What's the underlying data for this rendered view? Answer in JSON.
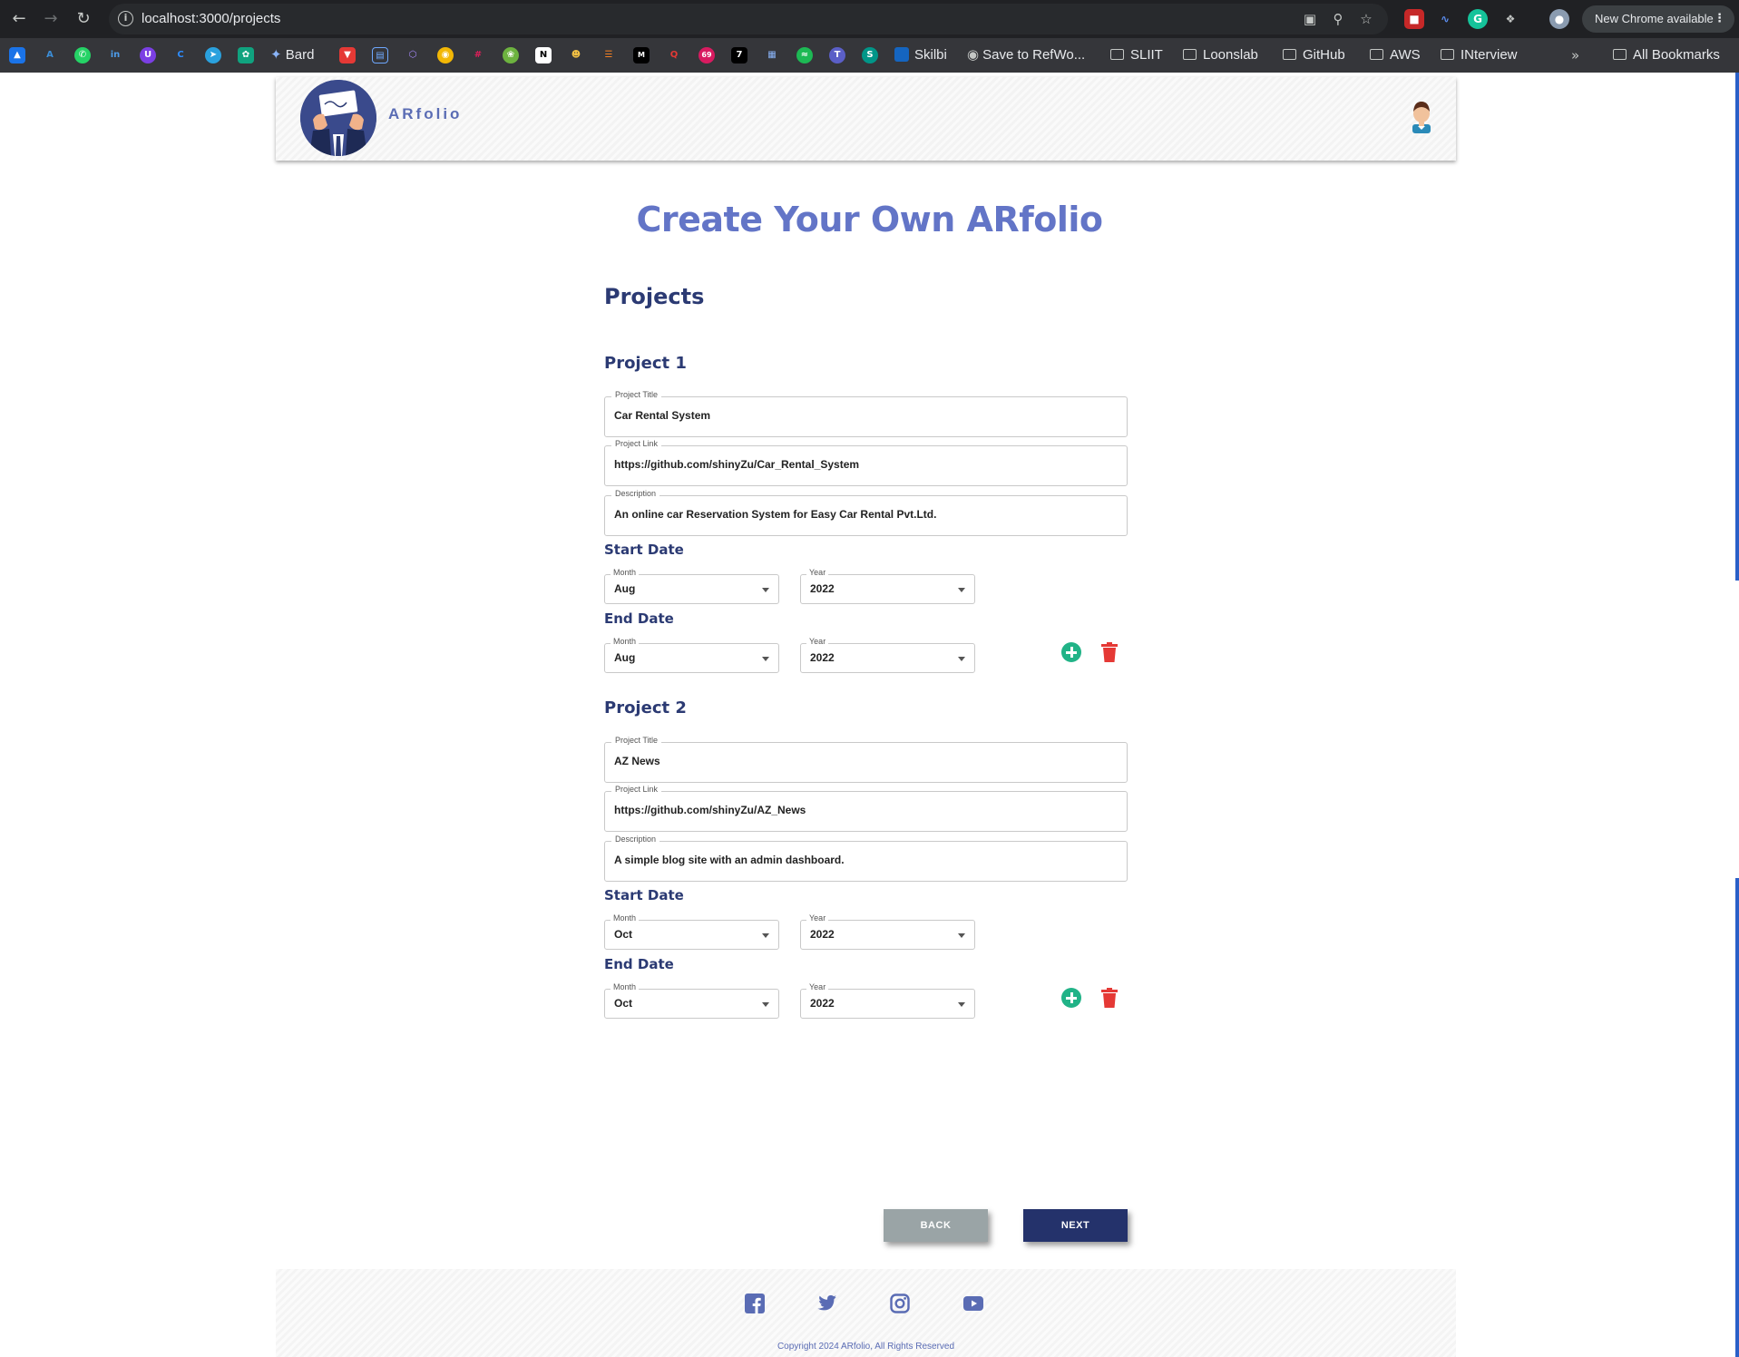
{
  "browser": {
    "url": "localhost:3000/projects",
    "update_label": "New Chrome available",
    "bookmarks": {
      "bard": "Bard",
      "skilbi": "Skilbi",
      "refworks": "Save to RefWo...",
      "sliit": "SLIIT",
      "loonslab": "Loonslab",
      "github": "GitHub",
      "aws": "AWS",
      "interview": "INterview",
      "all": "All Bookmarks"
    }
  },
  "header": {
    "brand": "ARfolio"
  },
  "page": {
    "title": "Create Your Own ARfolio",
    "section": "Projects"
  },
  "labels": {
    "project_title": "Project Title",
    "project_link": "Project Link",
    "description": "Description",
    "start_date": "Start Date",
    "end_date": "End Date",
    "month": "Month",
    "year": "Year"
  },
  "projects": [
    {
      "heading": "Project 1",
      "title": "Car Rental System",
      "link": "https://github.com/shinyZu/Car_Rental_System",
      "description": "An online car Reservation System for Easy Car Rental Pvt.Ltd.",
      "start_month": "Aug",
      "start_year": "2022",
      "end_month": "Aug",
      "end_year": "2022"
    },
    {
      "heading": "Project 2",
      "title": "AZ News",
      "link": "https://github.com/shinyZu/AZ_News",
      "description": "A simple blog site with an admin dashboard.",
      "start_month": "Oct",
      "start_year": "2022",
      "end_month": "Oct",
      "end_year": "2022"
    }
  ],
  "buttons": {
    "back": "BACK",
    "next": "NEXT"
  },
  "footer": {
    "copyright": "Copyright 2024 ARfolio, All Rights Reserved"
  },
  "colors": {
    "primary": "#6375c7",
    "dark_navy": "#24326b",
    "add_green": "#21b387",
    "delete_red": "#e53935",
    "back_gray": "#9aa4a6"
  }
}
